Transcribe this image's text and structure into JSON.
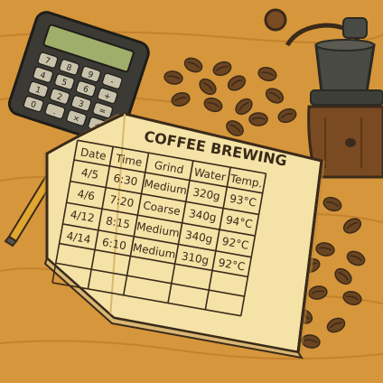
{
  "notebook": {
    "title": "COFFEE BREWING",
    "headers": [
      "Date",
      "Time",
      "Grind",
      "Water",
      "Temp."
    ],
    "rows": [
      [
        "4/5",
        "6:30",
        "Medium",
        "320g",
        "93°C"
      ],
      [
        "4/6",
        "7:20",
        "Coarse",
        "340g",
        "94°C"
      ],
      [
        "4/12",
        "8:15",
        "Medium",
        "340g",
        "92°C"
      ],
      [
        "4/14",
        "6:10",
        "Medium",
        "310g",
        "92°C"
      ]
    ]
  },
  "calculator": {
    "keys": [
      "7",
      "8",
      "9",
      "-",
      "4",
      "5",
      "6",
      "+",
      "1",
      "2",
      "3",
      "=",
      "0",
      ".",
      "×",
      "÷"
    ]
  },
  "colors": {
    "table": "#d9973a",
    "paper": "#f5e2a6",
    "ink": "#3a2a1a",
    "grinder_wood": "#7a4a22",
    "bean": "#6b4420"
  }
}
